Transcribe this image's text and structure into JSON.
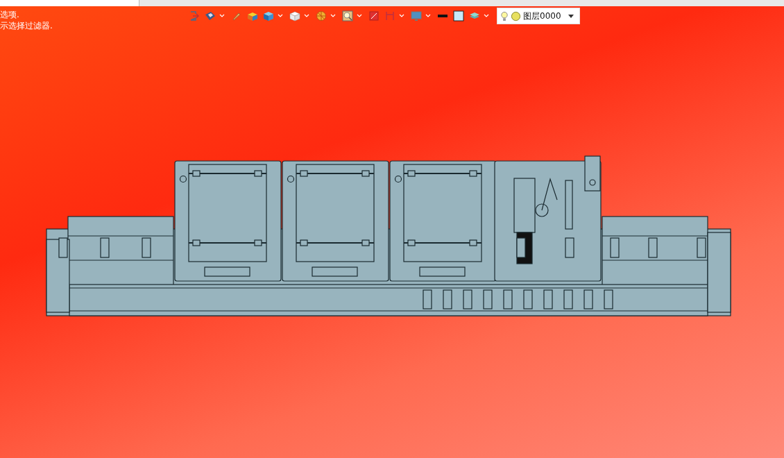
{
  "prompt_lines": [
    "选项.",
    "示选择过滤器."
  ],
  "toolbar": [
    {
      "dropdown": false
    },
    {
      "dropdown": true
    },
    {
      "dropdown": false
    },
    {
      "dropdown": false
    },
    {
      "dropdown": true
    },
    {
      "dropdown": true
    },
    {
      "dropdown": true
    },
    {
      "dropdown": true
    },
    {
      "dropdown": false
    },
    {
      "dropdown": true
    },
    {
      "dropdown": true
    },
    {
      "dropdown": false
    },
    {
      "dropdown": false
    },
    {
      "dropdown": true
    }
  ],
  "layer_combo": {
    "value": "图层0000"
  }
}
